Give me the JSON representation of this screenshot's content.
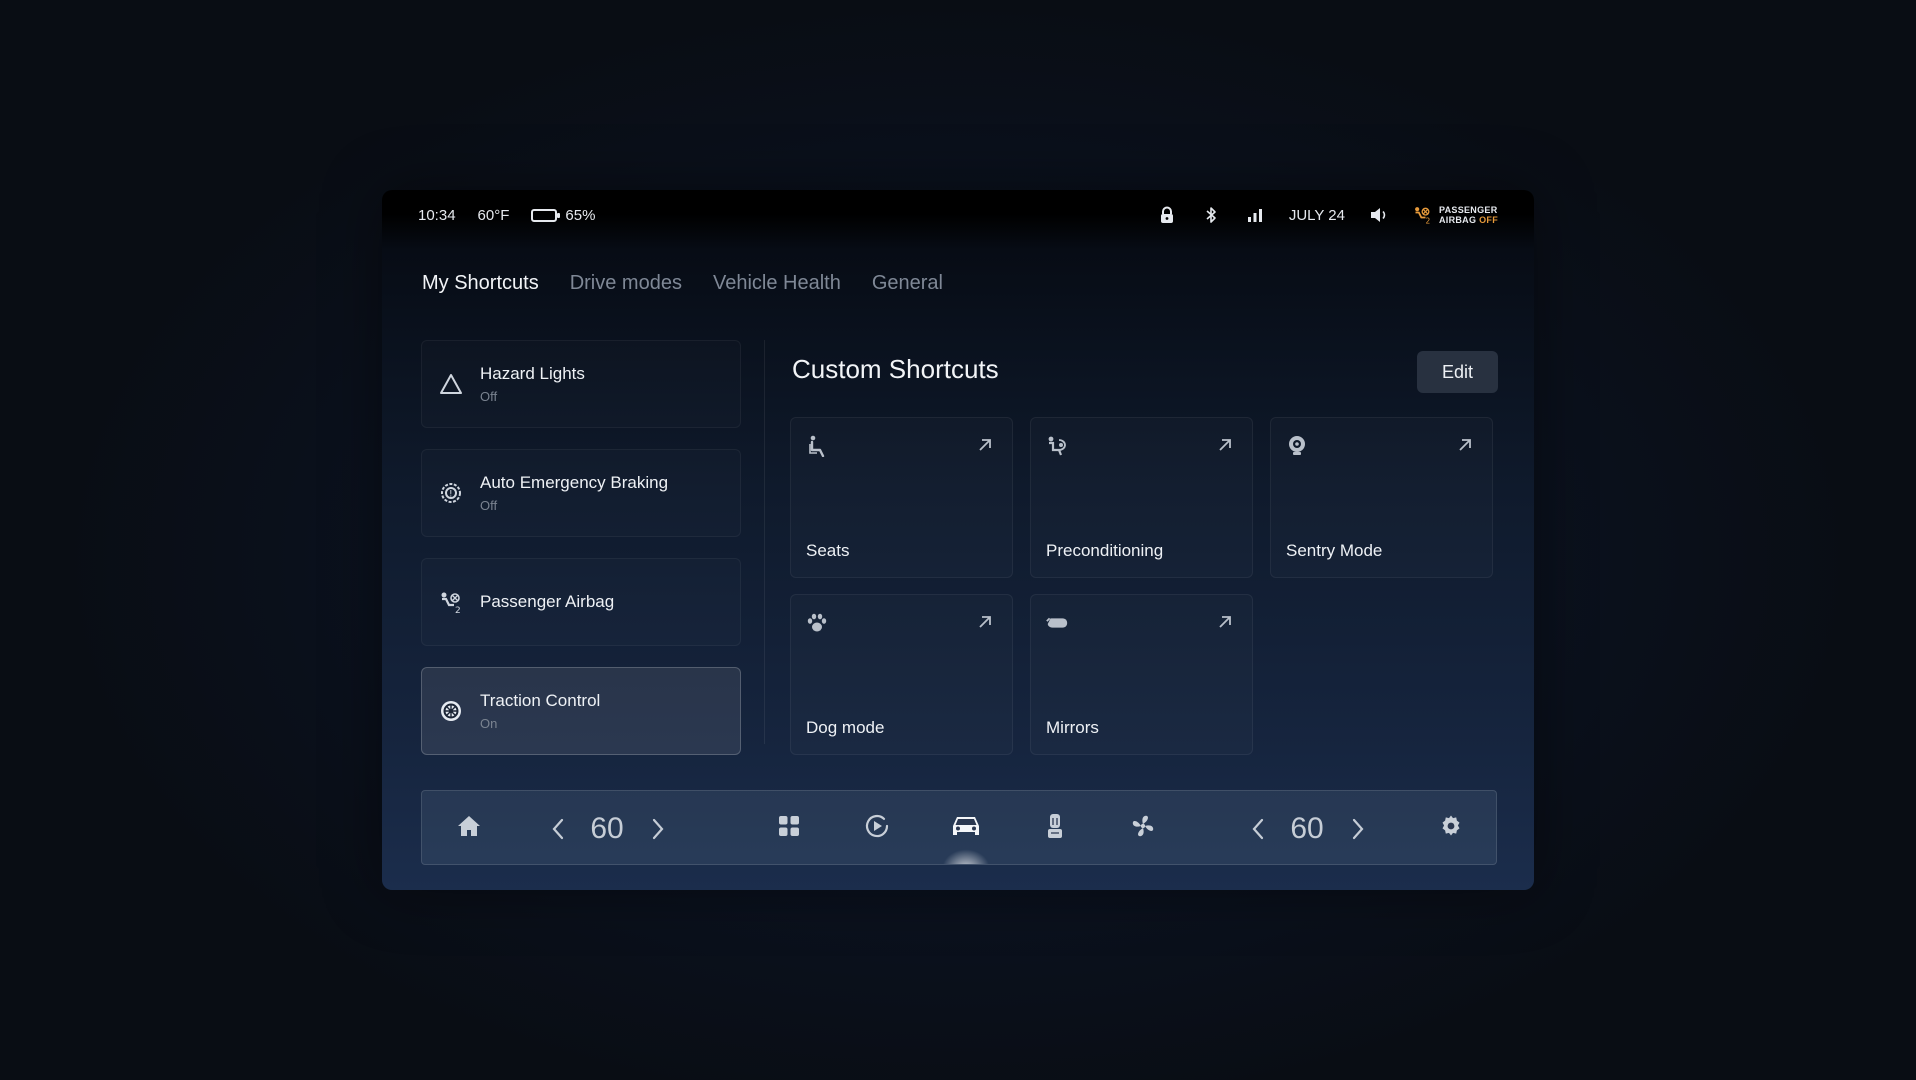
{
  "status": {
    "time": "10:34",
    "temperature": "60°F",
    "battery_percent": "65%",
    "battery_level": 0.65,
    "date": "JULY 24",
    "airbag_line1": "PASSENGER",
    "airbag_line2a": "AIRBAG",
    "airbag_line2b": "OFF",
    "icons": [
      "lock-icon",
      "bluetooth-icon",
      "signal-icon",
      "volume-icon",
      "airbag-off-icon"
    ]
  },
  "tabs": [
    {
      "label": "My Shortcuts",
      "active": true
    },
    {
      "label": "Drive modes",
      "active": false
    },
    {
      "label": "Vehicle Health",
      "active": false
    },
    {
      "label": "General",
      "active": false
    }
  ],
  "quick_controls": [
    {
      "title": "Hazard Lights",
      "status": "Off",
      "icon": "hazard-icon"
    },
    {
      "title": "Auto Emergency Braking",
      "status": "Off",
      "icon": "brake-icon"
    },
    {
      "title": "Passenger Airbag",
      "status": "",
      "icon": "airbag-icon"
    },
    {
      "title": "Traction Control",
      "status": "On",
      "icon": "traction-icon",
      "active": true
    }
  ],
  "custom": {
    "title": "Custom Shortcuts",
    "edit_label": "Edit",
    "cards": [
      {
        "label": "Seats",
        "icon": "seat-icon"
      },
      {
        "label": "Preconditioning",
        "icon": "preconditioning-icon"
      },
      {
        "label": "Sentry Mode",
        "icon": "sentry-icon"
      },
      {
        "label": "Dog mode",
        "icon": "paw-icon"
      },
      {
        "label": "Mirrors",
        "icon": "mirror-icon"
      }
    ]
  },
  "dock": {
    "left_temp": "60",
    "right_temp": "60",
    "icons": [
      "home-icon",
      "apps-icon",
      "media-icon",
      "car-icon",
      "seat-heat-icon",
      "fan-icon",
      "settings-icon"
    ],
    "active": "car-icon"
  },
  "colors": {
    "battery_fill": "#35d6b2",
    "airbag_off": "#e79a3a"
  }
}
